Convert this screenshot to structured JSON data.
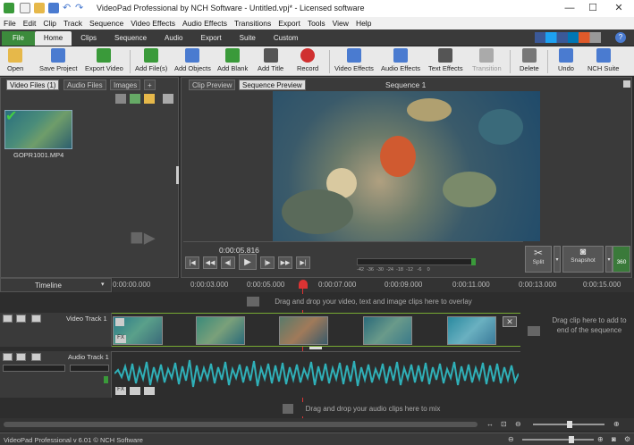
{
  "window": {
    "title": "VideoPad Professional by NCH Software - Untitled.vpj* - Licensed software",
    "min": "—",
    "max": "☐",
    "close": "✕"
  },
  "menu": [
    "File",
    "Edit",
    "Clip",
    "Track",
    "Sequence",
    "Video Effects",
    "Audio Effects",
    "Transitions",
    "Export",
    "Tools",
    "View",
    "Help"
  ],
  "tabs": [
    "File",
    "Home",
    "Clips",
    "Sequence",
    "Audio",
    "Export",
    "Suite",
    "Custom"
  ],
  "ribbon": [
    {
      "label": "Open",
      "color": "#e6b84a"
    },
    {
      "label": "Save Project",
      "color": "#4a7bd0"
    },
    {
      "label": "Export Video",
      "color": "#3a9a3a"
    },
    {
      "label": "Add File(s)",
      "color": "#3a9a3a"
    },
    {
      "label": "Add Objects",
      "color": "#4a7bd0"
    },
    {
      "label": "Add Blank",
      "color": "#3a9a3a"
    },
    {
      "label": "Add Title",
      "color": "#555555"
    },
    {
      "label": "Record",
      "color": "#d03030"
    },
    {
      "label": "Video Effects",
      "color": "#4a7bd0"
    },
    {
      "label": "Audio Effects",
      "color": "#4a7bd0"
    },
    {
      "label": "Text Effects",
      "color": "#555555"
    },
    {
      "label": "Transition",
      "color": "#aaaaaa"
    },
    {
      "label": "Delete",
      "color": "#777777"
    },
    {
      "label": "Undo",
      "color": "#4a7bd0"
    },
    {
      "label": "NCH Suite",
      "color": "#4a7bd0"
    }
  ],
  "bin": {
    "tabs": [
      "Video Files",
      "Audio Files",
      "Images",
      "+"
    ],
    "count": "(1)",
    "clip_name": "GOPR1001.MP4"
  },
  "preview": {
    "tabs": [
      "Clip Preview",
      "Sequence Preview"
    ],
    "title": "Sequence 1",
    "time": "0:00:05.816",
    "meter": "-42  -36  -30  -24  -18  -12   -6    0",
    "split": "Split",
    "snapshot": "Snapshot",
    "deg": "360"
  },
  "timeline": {
    "label": "Timeline",
    "ticks": [
      "0:00:00.000",
      "0:00:03.000",
      "0:00:05.000",
      "0:00:07.000",
      "0:00:09.000",
      "0:00:11.000",
      "0:00:13.000",
      "0:00:15.000"
    ],
    "overlay_hint": "Drag and drop your video, text and image clips here to overlay",
    "video_track": "Video Track 1",
    "audio_track": "Audio Track 1",
    "drag_end": "Drag clip here to add to end of the sequence",
    "audio_hint": "Drag and drop your audio clips here to mix"
  },
  "status": "VideoPad Professional v 6.01 © NCH Software"
}
